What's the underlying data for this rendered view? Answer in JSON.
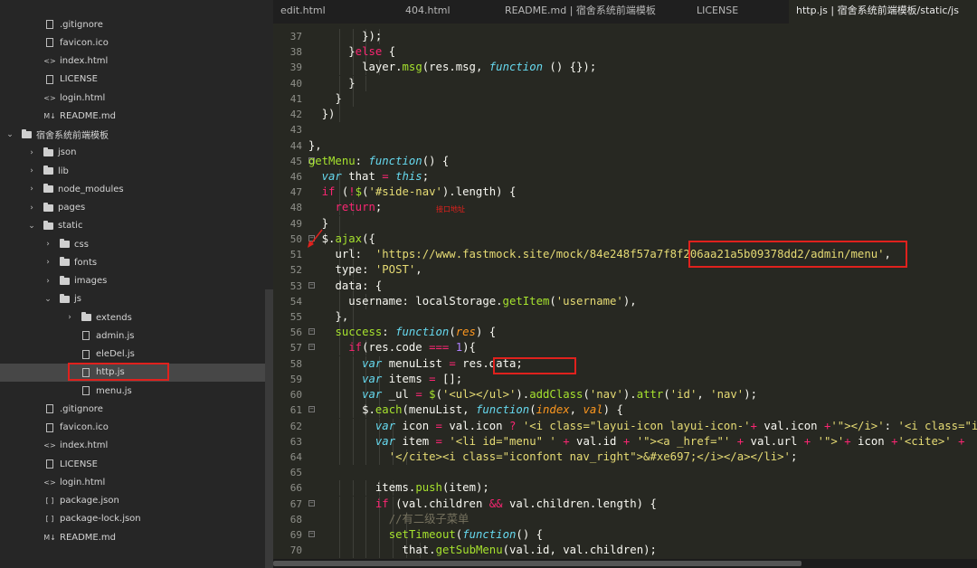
{
  "tabs": [
    {
      "label": "edit.html",
      "active": false
    },
    {
      "label": "404.html",
      "active": false
    },
    {
      "label": "README.md | 宿舍系统前端模板",
      "active": false
    },
    {
      "label": "LICENSE",
      "active": false
    },
    {
      "label": "http.js | 宿舍系统前端模板/static/js",
      "active": true
    }
  ],
  "sidebar": {
    "items": [
      {
        "label": ".gitignore",
        "icon": "file-icon",
        "depth": 2
      },
      {
        "label": "favicon.ico",
        "icon": "image-icon",
        "depth": 2
      },
      {
        "label": "index.html",
        "icon": "html-icon",
        "depth": 2
      },
      {
        "label": "LICENSE",
        "icon": "file-icon",
        "depth": 2
      },
      {
        "label": "login.html",
        "icon": "html-icon",
        "depth": 2
      },
      {
        "label": "README.md",
        "icon": "markdown-icon",
        "depth": 2
      },
      {
        "label": "宿舍系统前端模板",
        "icon": "folder-open-icon",
        "depth": 0,
        "arrow": "down"
      },
      {
        "label": "json",
        "icon": "folder-icon",
        "depth": 1,
        "arrow": "right"
      },
      {
        "label": "lib",
        "icon": "folder-icon",
        "depth": 1,
        "arrow": "right"
      },
      {
        "label": "node_modules",
        "icon": "folder-icon",
        "depth": 1,
        "arrow": "right"
      },
      {
        "label": "pages",
        "icon": "folder-icon",
        "depth": 1,
        "arrow": "right"
      },
      {
        "label": "static",
        "icon": "folder-open-icon",
        "depth": 1,
        "arrow": "down"
      },
      {
        "label": "css",
        "icon": "folder-icon",
        "depth": 2,
        "arrow": "right"
      },
      {
        "label": "fonts",
        "icon": "folder-icon",
        "depth": 2,
        "arrow": "right"
      },
      {
        "label": "images",
        "icon": "folder-icon",
        "depth": 2,
        "arrow": "right"
      },
      {
        "label": "js",
        "icon": "folder-open-icon",
        "depth": 2,
        "arrow": "down"
      },
      {
        "label": "extends",
        "icon": "folder-icon",
        "depth": 3,
        "arrow": "right"
      },
      {
        "label": "admin.js",
        "icon": "js-file-icon",
        "depth": 4
      },
      {
        "label": "eleDel.js",
        "icon": "js-file-icon",
        "depth": 4
      },
      {
        "label": "http.js",
        "icon": "js-file-icon",
        "depth": 4,
        "selected": true
      },
      {
        "label": "menu.js",
        "icon": "js-file-icon",
        "depth": 4
      },
      {
        "label": ".gitignore",
        "icon": "file-icon",
        "depth": 2
      },
      {
        "label": "favicon.ico",
        "icon": "image-icon",
        "depth": 2
      },
      {
        "label": "index.html",
        "icon": "html-icon",
        "depth": 2
      },
      {
        "label": "LICENSE",
        "icon": "file-icon",
        "depth": 2
      },
      {
        "label": "login.html",
        "icon": "html-icon",
        "depth": 2
      },
      {
        "label": "package.json",
        "icon": "json-icon",
        "depth": 2
      },
      {
        "label": "package-lock.json",
        "icon": "json-icon",
        "depth": 2
      },
      {
        "label": "README.md",
        "icon": "markdown-icon",
        "depth": 2
      }
    ]
  },
  "annotation": "接口地址",
  "code": [
    {
      "n": "37",
      "fold": false,
      "indent": 5,
      "t": [
        [
          "p",
          "});"
        ]
      ]
    },
    {
      "n": "38",
      "fold": false,
      "indent": 4,
      "t": [
        [
          "p",
          "}"
        ],
        [
          "kw",
          "else"
        ],
        [
          "p",
          " {"
        ]
      ]
    },
    {
      "n": "39",
      "fold": false,
      "indent": 5,
      "t": [
        [
          "p",
          "layer."
        ],
        [
          "fn",
          "msg"
        ],
        [
          "p",
          "(res.msg, "
        ],
        [
          "it",
          "function"
        ],
        [
          "p",
          " () {});"
        ]
      ]
    },
    {
      "n": "40",
      "fold": false,
      "indent": 4,
      "t": [
        [
          "p",
          "}"
        ]
      ]
    },
    {
      "n": "41",
      "fold": false,
      "indent": 3,
      "t": [
        [
          "p",
          "}"
        ]
      ]
    },
    {
      "n": "42",
      "fold": false,
      "indent": 2,
      "t": [
        [
          "p",
          "})"
        ]
      ]
    },
    {
      "n": "43",
      "fold": false,
      "indent": 0,
      "t": []
    },
    {
      "n": "44",
      "fold": false,
      "indent": 1,
      "t": [
        [
          "p",
          "},"
        ]
      ]
    },
    {
      "n": "45",
      "fold": true,
      "indent": 1,
      "t": [
        [
          "fn",
          "getMenu"
        ],
        [
          "p",
          ": "
        ],
        [
          "it",
          "function"
        ],
        [
          "p",
          "() {"
        ]
      ]
    },
    {
      "n": "46",
      "fold": false,
      "indent": 2,
      "t": [
        [
          "it",
          "var"
        ],
        [
          "p",
          " that "
        ],
        [
          "kw",
          "="
        ],
        [
          "p",
          " "
        ],
        [
          "it",
          "this"
        ],
        [
          "p",
          ";"
        ]
      ]
    },
    {
      "n": "47",
      "fold": false,
      "indent": 2,
      "t": [
        [
          "kw",
          "if"
        ],
        [
          "p",
          " ("
        ],
        [
          "kw",
          "!"
        ],
        [
          "fn",
          "$"
        ],
        [
          "p",
          "("
        ],
        [
          "st",
          "'#side-nav'"
        ],
        [
          "p",
          ").length) {"
        ]
      ]
    },
    {
      "n": "48",
      "fold": false,
      "indent": 3,
      "t": [
        [
          "kw",
          "return"
        ],
        [
          "p",
          ";"
        ]
      ]
    },
    {
      "n": "49",
      "fold": false,
      "indent": 2,
      "t": [
        [
          "p",
          "}"
        ]
      ]
    },
    {
      "n": "50",
      "fold": true,
      "indent": 2,
      "t": [
        [
          "p",
          "$."
        ],
        [
          "fn",
          "ajax"
        ],
        [
          "p",
          "({"
        ]
      ]
    },
    {
      "n": "51",
      "fold": false,
      "indent": 3,
      "t": [
        [
          "p",
          "url:  "
        ],
        [
          "st",
          "'https://www.fastmock.site/mock/84e248f57a7f8f206aa21a5b09378dd2/admin/menu'"
        ],
        [
          "p",
          ","
        ]
      ]
    },
    {
      "n": "52",
      "fold": false,
      "indent": 3,
      "t": [
        [
          "p",
          "type: "
        ],
        [
          "st",
          "'POST'"
        ],
        [
          "p",
          ","
        ]
      ]
    },
    {
      "n": "53",
      "fold": true,
      "indent": 3,
      "t": [
        [
          "p",
          "data: {"
        ]
      ]
    },
    {
      "n": "54",
      "fold": false,
      "indent": 4,
      "t": [
        [
          "p",
          "username: localStorage."
        ],
        [
          "fn",
          "getItem"
        ],
        [
          "p",
          "("
        ],
        [
          "st",
          "'username'"
        ],
        [
          "p",
          "),"
        ]
      ]
    },
    {
      "n": "55",
      "fold": false,
      "indent": 3,
      "t": [
        [
          "p",
          "},"
        ]
      ]
    },
    {
      "n": "56",
      "fold": true,
      "indent": 3,
      "t": [
        [
          "fn",
          "success"
        ],
        [
          "p",
          ": "
        ],
        [
          "it",
          "function"
        ],
        [
          "p",
          "("
        ],
        [
          "pa",
          "res"
        ],
        [
          "p",
          ") {"
        ]
      ]
    },
    {
      "n": "57",
      "fold": true,
      "indent": 4,
      "t": [
        [
          "kw",
          "if"
        ],
        [
          "p",
          "(res.code "
        ],
        [
          "kw",
          "==="
        ],
        [
          "p",
          " "
        ],
        [
          "nm",
          "1"
        ],
        [
          "p",
          "){"
        ]
      ]
    },
    {
      "n": "58",
      "fold": false,
      "indent": 5,
      "t": [
        [
          "it",
          "var"
        ],
        [
          "p",
          " menuList "
        ],
        [
          "kw",
          "="
        ],
        [
          "p",
          " res.data;"
        ]
      ]
    },
    {
      "n": "59",
      "fold": false,
      "indent": 5,
      "t": [
        [
          "it",
          "var"
        ],
        [
          "p",
          " items "
        ],
        [
          "kw",
          "="
        ],
        [
          "p",
          " [];"
        ]
      ]
    },
    {
      "n": "60",
      "fold": false,
      "indent": 5,
      "t": [
        [
          "it",
          "var"
        ],
        [
          "p",
          " _ul "
        ],
        [
          "kw",
          "="
        ],
        [
          "p",
          " "
        ],
        [
          "fn",
          "$"
        ],
        [
          "p",
          "("
        ],
        [
          "st",
          "'<ul></ul>'"
        ],
        [
          "p",
          ")."
        ],
        [
          "fn",
          "addClass"
        ],
        [
          "p",
          "("
        ],
        [
          "st",
          "'nav'"
        ],
        [
          "p",
          ")."
        ],
        [
          "fn",
          "attr"
        ],
        [
          "p",
          "("
        ],
        [
          "st",
          "'id'"
        ],
        [
          "p",
          ", "
        ],
        [
          "st",
          "'nav'"
        ],
        [
          "p",
          ");"
        ]
      ]
    },
    {
      "n": "61",
      "fold": true,
      "indent": 5,
      "t": [
        [
          "p",
          "$."
        ],
        [
          "fn",
          "each"
        ],
        [
          "p",
          "(menuList, "
        ],
        [
          "it",
          "function"
        ],
        [
          "p",
          "("
        ],
        [
          "pa",
          "index"
        ],
        [
          "p",
          ", "
        ],
        [
          "pa",
          "val"
        ],
        [
          "p",
          ") {"
        ]
      ]
    },
    {
      "n": "62",
      "fold": false,
      "indent": 6,
      "t": [
        [
          "it",
          "var"
        ],
        [
          "p",
          " icon "
        ],
        [
          "kw",
          "="
        ],
        [
          "p",
          " val.icon "
        ],
        [
          "kw",
          "?"
        ],
        [
          "p",
          " "
        ],
        [
          "st",
          "'<i class=\"layui-icon layui-icon-'"
        ],
        [
          "kw",
          "+"
        ],
        [
          "p",
          " val.icon "
        ],
        [
          "kw",
          "+"
        ],
        [
          "st",
          "'\"></i>'"
        ],
        [
          "p",
          ": "
        ],
        [
          "st",
          "'<i class=\"iconfont\">'"
        ]
      ]
    },
    {
      "n": "63",
      "fold": false,
      "indent": 6,
      "t": [
        [
          "it",
          "var"
        ],
        [
          "p",
          " item "
        ],
        [
          "kw",
          "="
        ],
        [
          "p",
          " "
        ],
        [
          "st",
          "'<li id=\"menu\" '"
        ],
        [
          "p",
          " "
        ],
        [
          "kw",
          "+"
        ],
        [
          "p",
          " val.id "
        ],
        [
          "kw",
          "+"
        ],
        [
          "p",
          " "
        ],
        [
          "st",
          "'\"><a _href=\"'"
        ],
        [
          "p",
          " "
        ],
        [
          "kw",
          "+"
        ],
        [
          "p",
          " val.url "
        ],
        [
          "kw",
          "+"
        ],
        [
          "p",
          " "
        ],
        [
          "st",
          "'\">'"
        ],
        [
          "kw",
          "+"
        ],
        [
          "p",
          " icon "
        ],
        [
          "kw",
          "+"
        ],
        [
          "st",
          "'<cite>'"
        ],
        [
          "p",
          " "
        ],
        [
          "kw",
          "+"
        ]
      ]
    },
    {
      "n": "64",
      "fold": false,
      "indent": 7,
      "t": [
        [
          "st",
          "'</cite><i class=\"iconfont nav_right\">&#xe697;</i></a></li>'"
        ],
        [
          "p",
          ";"
        ]
      ]
    },
    {
      "n": "65",
      "fold": false,
      "indent": 0,
      "t": []
    },
    {
      "n": "66",
      "fold": false,
      "indent": 6,
      "t": [
        [
          "p",
          "items."
        ],
        [
          "fn",
          "push"
        ],
        [
          "p",
          "(item);"
        ]
      ]
    },
    {
      "n": "67",
      "fold": true,
      "indent": 6,
      "t": [
        [
          "kw",
          "if"
        ],
        [
          "p",
          " (val.children "
        ],
        [
          "kw",
          "&&"
        ],
        [
          "p",
          " val.children.length) {"
        ]
      ]
    },
    {
      "n": "68",
      "fold": false,
      "indent": 7,
      "t": [
        [
          "cm",
          "//有二级子菜单"
        ]
      ]
    },
    {
      "n": "69",
      "fold": true,
      "indent": 7,
      "t": [
        [
          "fn",
          "setTimeout"
        ],
        [
          "p",
          "("
        ],
        [
          "it",
          "function"
        ],
        [
          "p",
          "() {"
        ]
      ]
    },
    {
      "n": "70",
      "fold": false,
      "indent": 8,
      "t": [
        [
          "p",
          "that."
        ],
        [
          "fn",
          "getSubMenu"
        ],
        [
          "p",
          "(val.id, val.children);"
        ]
      ]
    }
  ]
}
